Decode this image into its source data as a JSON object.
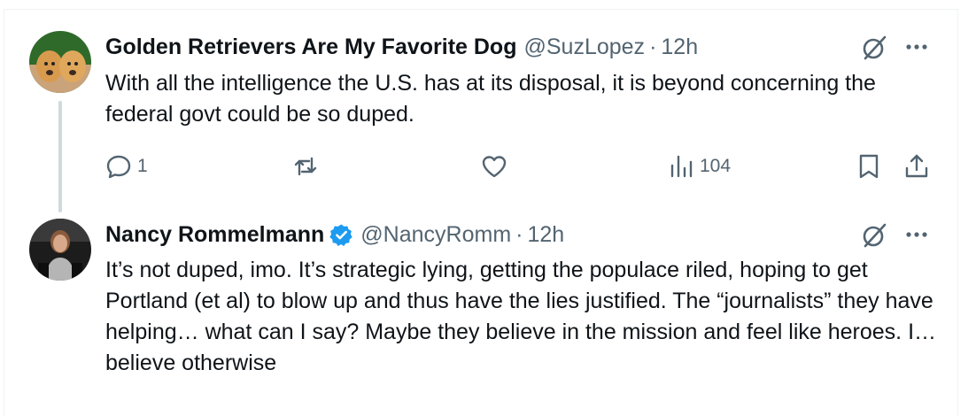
{
  "tweets": [
    {
      "name": "Golden Retrievers Are My Favorite Dog",
      "handle": "@SuzLopez",
      "dot": "·",
      "time": "12h",
      "text": "With all the intelligence the U.S. has at its disposal, it is beyond concerning the federal govt could be so duped.",
      "reply_count": "1",
      "views": "104"
    },
    {
      "name": "Nancy Rommelmann",
      "handle": "@NancyRomm",
      "dot": "·",
      "time": "12h",
      "verified": true,
      "text": "It’s not duped, imo. It’s strategic lying, getting the populace riled, hoping to get Portland (et al) to blow up and thus have the lies justified. The “journalists” they have helping… what can I say? Maybe they believe in the mission and feel like heroes. I… believe otherwise"
    }
  ],
  "colors": {
    "text": "#0f1419",
    "secondary": "#536471",
    "verified": "#1d9bf0",
    "border": "#eff3f4",
    "thread_line": "#cfd9de"
  },
  "icons": [
    "grok-icon",
    "more-icon",
    "reply-icon",
    "repost-icon",
    "like-icon",
    "views-icon",
    "bookmark-icon",
    "share-icon",
    "verified-badge-icon"
  ]
}
